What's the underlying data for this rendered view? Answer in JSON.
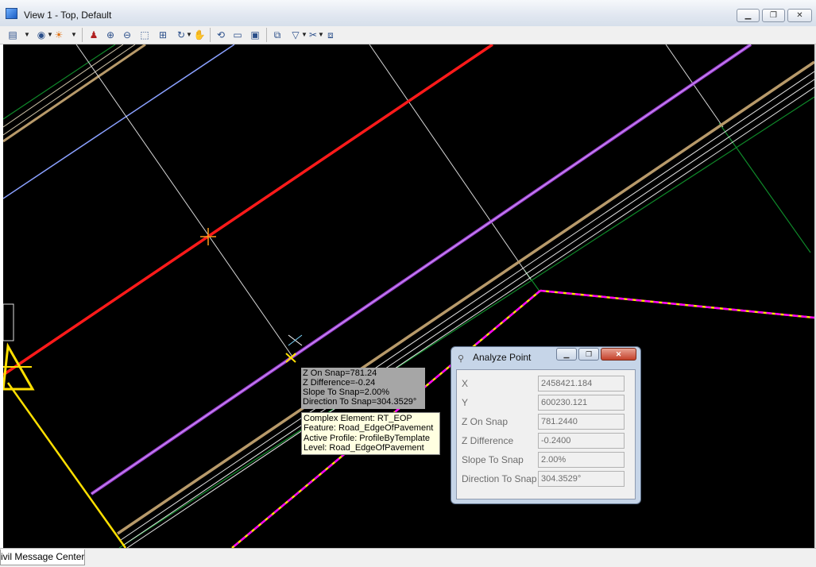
{
  "window": {
    "title": "View 1 - Top, Default",
    "minimize_label": "▁",
    "maximize_label": "❐",
    "close_label": "✕"
  },
  "toolbar": {
    "icons": [
      "view-attributes-icon",
      "dropdown-arrow-icon",
      "view-display-icon",
      "view-display-dropdown-icon",
      "brightness-icon",
      "brightness-dropdown-icon",
      "update-view-icon",
      "zoom-in-icon",
      "zoom-out-icon",
      "window-area-icon",
      "fit-view-icon",
      "rotate-view-icon",
      "rotate-dropdown-icon",
      "pan-view-icon",
      "view-previous-icon",
      "view-next-icon",
      "copy-view-icon",
      "camera-icon",
      "clip-volume-icon",
      "clip-mask-icon",
      "clip-dropdown-icon",
      "tools-icon",
      "tools-dropdown-icon",
      "saved-view-icon"
    ]
  },
  "snap_tooltip": {
    "line1": "Z On Snap=781.24",
    "line2": "Z Difference=-0.24",
    "line3": "Slope To Snap=2.00%",
    "line4": "Direction To Snap=304.3529°"
  },
  "element_tooltip": {
    "line1": "Complex Element: RT_EOP",
    "line2": "Feature: Road_EdgeOfPavement",
    "line3": "Active Profile: ProfileByTemplate",
    "line4": "Level: Road_EdgeOfPavement"
  },
  "analyze_point": {
    "title": "Analyze Point",
    "fields": [
      {
        "label": "X",
        "value": "2458421.184"
      },
      {
        "label": "Y",
        "value": "600230.121"
      },
      {
        "label": "Z On Snap",
        "value": "781.2440"
      },
      {
        "label": "Z Difference",
        "value": "-0.2400"
      },
      {
        "label": "Slope To Snap",
        "value": "2.00%"
      },
      {
        "label": "Direction To Snap",
        "value": "304.3529°"
      }
    ]
  },
  "bottom_tab": {
    "label": "ivil Message Center"
  },
  "colors": {
    "background": "#000000",
    "red_line": "#ff1a1a",
    "purple_line": "#9b3fd0",
    "tan_line": "#b89a6a",
    "blue_line": "#8aa0ff",
    "yellow": "#ffe000",
    "magenta": "#ff00ff",
    "green": "#0f8a2a"
  }
}
